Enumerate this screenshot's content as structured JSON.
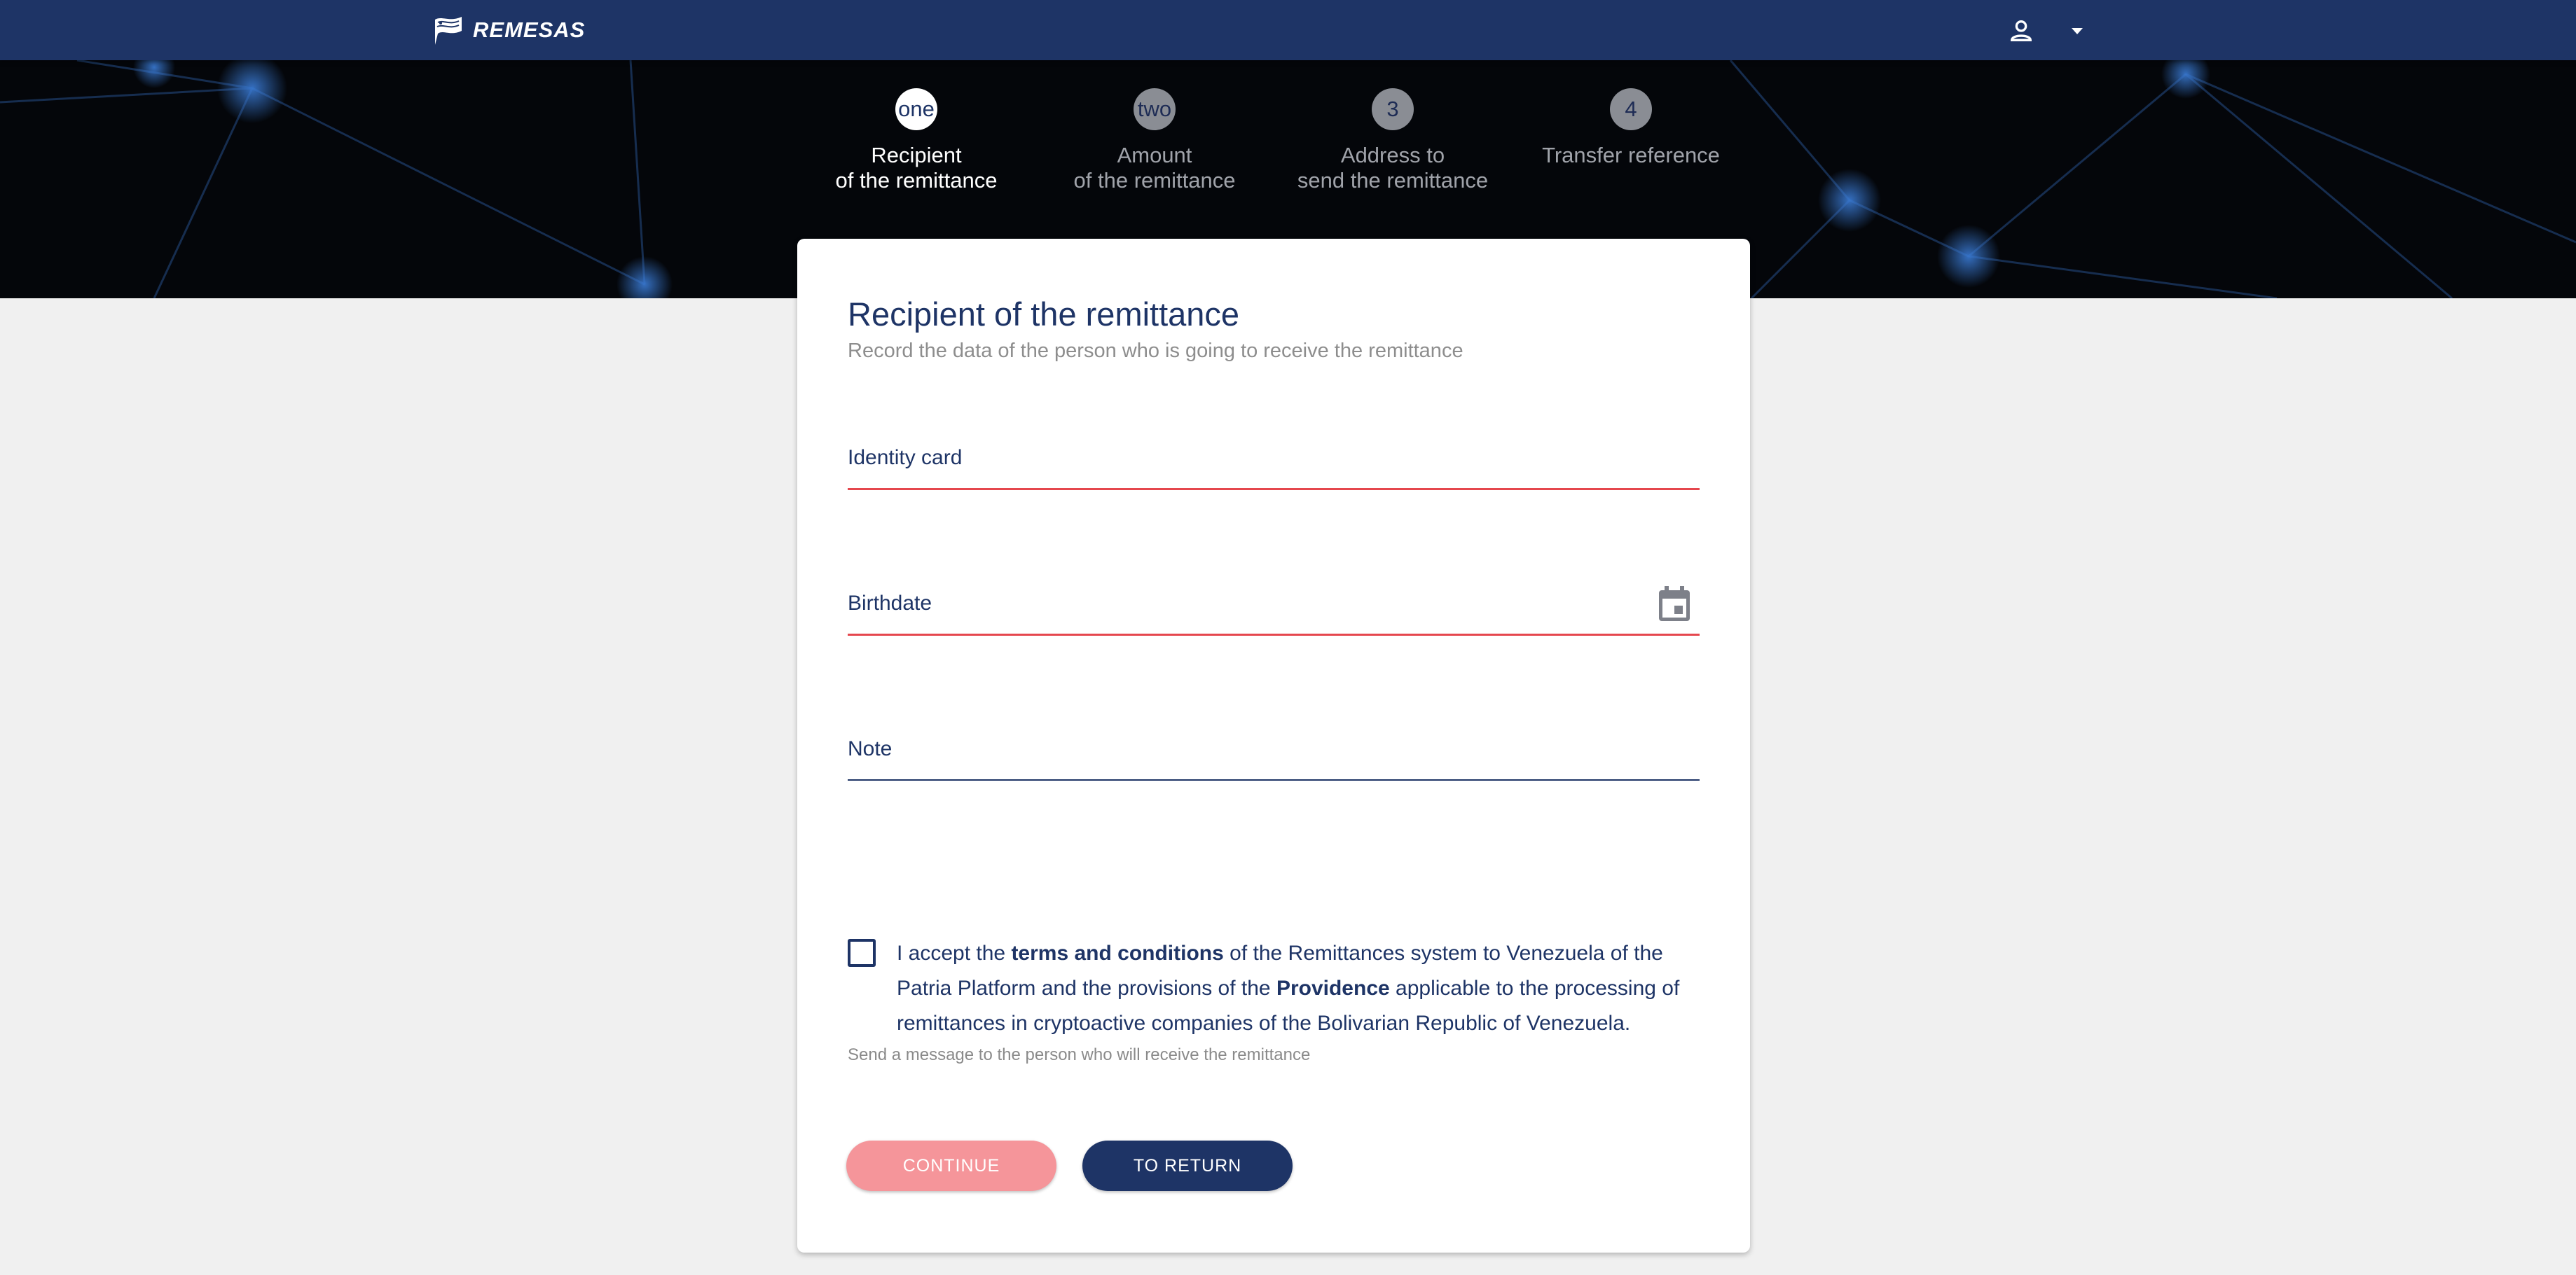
{
  "app": {
    "name": "REMESAS"
  },
  "header": {
    "user_icon": "user-icon",
    "menu_icon": "caret-down-icon"
  },
  "steps": [
    {
      "badge": "one",
      "line1": "Recipient",
      "line2": "of the remittance",
      "active": true
    },
    {
      "badge": "two",
      "line1": "Amount",
      "line2": "of the remittance",
      "active": false
    },
    {
      "badge": "3",
      "line1": "Address to",
      "line2": "send the remittance",
      "active": false
    },
    {
      "badge": "4",
      "line1": "Transfer reference",
      "line2": "",
      "active": false
    }
  ],
  "form": {
    "title": "Recipient of the remittance",
    "subtitle": "Record the data of the person who is going to receive the remittance",
    "fields": {
      "identity_card": {
        "label": "Identity card",
        "value": "",
        "state": "error"
      },
      "birthdate": {
        "label": "Birthdate",
        "value": "",
        "state": "error",
        "icon": "calendar-icon"
      },
      "note": {
        "label": "Note",
        "value": "",
        "hint": "Send a message to the person who will receive the remittance",
        "state": "normal"
      }
    },
    "terms": {
      "checked": false,
      "part1": "I accept the ",
      "link1": "terms and conditions",
      "part2": " of the Remittances system to Venezuela of the Patria Platform and the provisions of the ",
      "link2": "Providence",
      "part3": " applicable to the processing of remittances in cryptoactive companies of the Bolivarian Republic of Venezuela."
    },
    "buttons": {
      "continue": "CONTINUE",
      "return": "TO RETURN"
    }
  },
  "colors": {
    "primary": "#1e3466",
    "error": "#e5474e",
    "continue_disabled": "#f5959a",
    "background": "#f0f0f0"
  }
}
